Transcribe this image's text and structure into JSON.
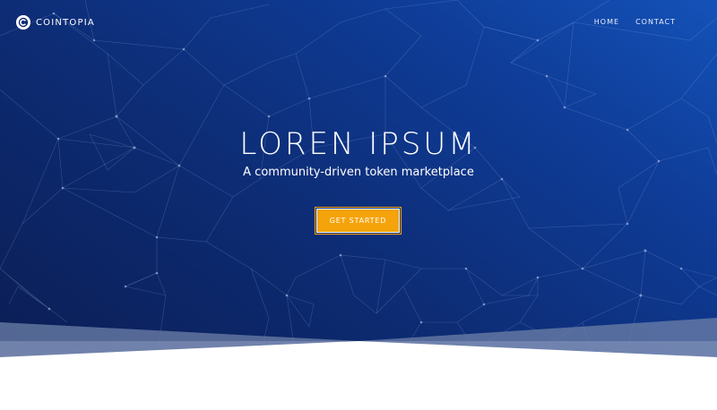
{
  "brand": {
    "name": "COINTOPIA",
    "logo_icon": "coin-c-icon"
  },
  "nav": {
    "items": [
      {
        "label": "HOME"
      },
      {
        "label": "CONTACT"
      }
    ]
  },
  "hero": {
    "title": "LOREN IPSUM",
    "subtitle": "A community-driven token marketplace",
    "cta_label": "GET STARTED",
    "background_pattern_icon": "network-mesh-icon"
  },
  "colors": {
    "hero_gradient_dark": "#0b1e55",
    "hero_gradient_light": "#1452b8",
    "cta_background": "#f5a30a",
    "text_primary": "#ffffff",
    "page_background": "#ffffff"
  }
}
